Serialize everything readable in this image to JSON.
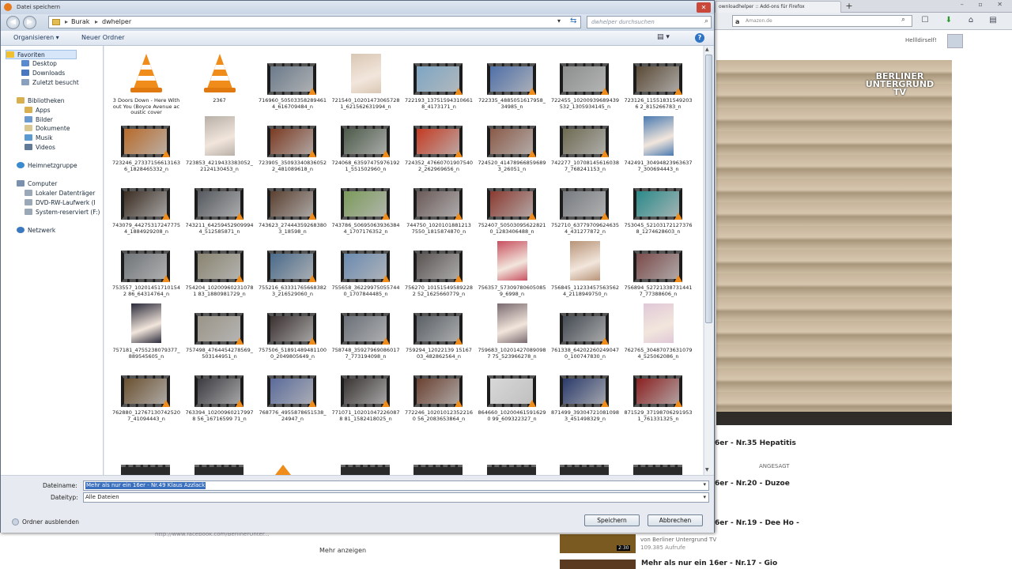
{
  "dialog": {
    "title": "Datei speichern",
    "breadcrumb": [
      "Burak",
      "dwhelper"
    ],
    "search_placeholder": "dwhelper durchsuchen",
    "toolbar": {
      "organize": "Organisieren ▾",
      "new_folder": "Neuer Ordner"
    },
    "nav": {
      "favorites": "Favoriten",
      "desktop": "Desktop",
      "downloads": "Downloads",
      "recent": "Zuletzt besucht",
      "libraries": "Bibliotheken",
      "apps": "Apps",
      "pictures": "Bilder",
      "documents": "Dokumente",
      "music": "Musik",
      "videos": "Videos",
      "homegroup": "Heimnetzgruppe",
      "computer": "Computer",
      "local_disk": "Lokaler Datenträger",
      "dvd": "DVD-RW-Laufwerk (I",
      "system_reserved": "System-reserviert (F:)",
      "network": "Netzwerk"
    },
    "files": [
      {
        "name": "3 Doors Down - Here Without You (Boyce Avenue acoustic cover",
        "kind": "vlc"
      },
      {
        "name": "2367",
        "kind": "vlc"
      },
      {
        "name": "716960_505033582894614_616709484_n",
        "kind": "video",
        "color": "#6b7a8a"
      },
      {
        "name": "721540_102014730657281_621562631994_n",
        "kind": "photo",
        "color": "#d9c7b4"
      },
      {
        "name": "722193_137515943106618_4173171_n",
        "kind": "video",
        "color": "#7da6c4"
      },
      {
        "name": "722335_4885051617958_34985_n",
        "kind": "video",
        "color": "#4f6fa8"
      },
      {
        "name": "722455_10200939689439532_1305934145_n",
        "kind": "video",
        "color": "#8d8f8f"
      },
      {
        "name": "723126_115518315492036 2_815266783_n",
        "kind": "video",
        "color": "#5a4a36"
      },
      {
        "name": "723246_273371566131636_1828465332_n",
        "kind": "video",
        "color": "#b86a2a"
      },
      {
        "name": "723853_4219433383052_2124130453_n",
        "kind": "photo",
        "color": "#b8b0a8"
      },
      {
        "name": "723905_350933408360522_481089618_n",
        "kind": "video",
        "color": "#7a3a22"
      },
      {
        "name": "724068_635974759761921_551502960_n",
        "kind": "video",
        "color": "#4d5a4a"
      },
      {
        "name": "724352_476607019075402_262969656_n",
        "kind": "video",
        "color": "#c43a22"
      },
      {
        "name": "724520_414789668596893_26051_n",
        "kind": "video",
        "color": "#8a5a48"
      },
      {
        "name": "742277_107081456160387_768241153_n",
        "kind": "video",
        "color": "#6e6a52"
      },
      {
        "name": "742491_304948239636377_300694443_n",
        "kind": "photo",
        "color": "#4a7ab0"
      },
      {
        "name": "743079_442753172477754_1884929208_n",
        "kind": "video",
        "color": "#3a2c22"
      },
      {
        "name": "743211_642594529099944_512585871_n",
        "kind": "video",
        "color": "#55595e"
      },
      {
        "name": "743623_274443592683803_18598_n",
        "kind": "video",
        "color": "#5a4030"
      },
      {
        "name": "743786_506950639363844_1707176352_n",
        "kind": "video",
        "color": "#7b9a5a"
      },
      {
        "name": "744750_1020101881213 7550_1815874870_n",
        "kind": "video",
        "color": "#6a5a58"
      },
      {
        "name": "752407_505030956228210_1283406488_n",
        "kind": "video",
        "color": "#8a3a30"
      },
      {
        "name": "752710_637797096246354_431277872_n",
        "kind": "video",
        "color": "#777b80"
      },
      {
        "name": "753045_521031721273768_1274628603_n",
        "kind": "video",
        "color": "#2a8a8a"
      },
      {
        "name": "753557_102014517101542 86_64314764_n",
        "kind": "video",
        "color": "#707478"
      },
      {
        "name": "754204_102009602310781 83_1880981729_n",
        "kind": "video",
        "color": "#8a8470"
      },
      {
        "name": "755216_633317656683823_216529060_n",
        "kind": "video",
        "color": "#4a6a8a"
      },
      {
        "name": "755658_362299750557440_1707844485_n",
        "kind": "video",
        "color": "#6a8ab0"
      },
      {
        "name": "756270_101515495892282 52_1625660779_n",
        "kind": "video",
        "color": "#5a5452"
      },
      {
        "name": "756357_573097806050859_6998_n",
        "kind": "photo",
        "color": "#c85060"
      },
      {
        "name": "756845_112334575635624_2118949750_n",
        "kind": "photo",
        "color": "#b89478"
      },
      {
        "name": "756894_527213387314417_77388606_n",
        "kind": "video",
        "color": "#7a4a4a"
      },
      {
        "name": "757181_4755238079377_889545605_n",
        "kind": "photo",
        "color": "#2a2a3a"
      },
      {
        "name": "757498_4764454278569_503144951_n",
        "kind": "video",
        "color": "#9a9488"
      },
      {
        "name": "757506_518914894811000_2049805649_n",
        "kind": "video",
        "color": "#3a3030"
      },
      {
        "name": "758748_359279690860177_773194098_n",
        "kind": "video",
        "color": "#6a7078"
      },
      {
        "name": "759294_12022139 1516703_482862564_n",
        "kind": "video",
        "color": "#5a6066"
      },
      {
        "name": "759683_102014270890987 75_523966278_n",
        "kind": "photo",
        "color": "#7a6a70"
      },
      {
        "name": "761338_642022602490470_100747830_n",
        "kind": "video",
        "color": "#444a52"
      },
      {
        "name": "762765_304870736310794_525062086_n",
        "kind": "photo",
        "color": "#e0c8d8"
      },
      {
        "name": "762880_127671307425207_41094443_n",
        "kind": "video",
        "color": "#6a5030"
      },
      {
        "name": "763394_102009602179978 56_16716599 71_n",
        "kind": "video",
        "color": "#3a3a40"
      },
      {
        "name": "768776_4955878651538_24947_n",
        "kind": "video",
        "color": "#5a6a9a"
      },
      {
        "name": "771071_102010472260878 81_1582418025_n",
        "kind": "video",
        "color": "#3a3434"
      },
      {
        "name": "772246_102010123522160 56_2083653864_n",
        "kind": "video",
        "color": "#6a4030"
      },
      {
        "name": "864660_102004615916290 99_609322327_n",
        "kind": "video",
        "color": "#d8d8d8"
      },
      {
        "name": "871499_393047210810983_451498329_n",
        "kind": "video",
        "color": "#2a3a6a"
      },
      {
        "name": "871529_371987062919531_761331325_n",
        "kind": "video",
        "color": "#8a2020"
      }
    ],
    "filename_label": "Dateiname:",
    "filename_value": "Mehr als nur ein 16er - Nr.49 Klaus Azzlack",
    "filetype_label": "Dateityp:",
    "filetype_value": "Alle Dateien",
    "hide_folders": "Ordner ausblenden",
    "save": "Speichern",
    "cancel": "Abbrechen"
  },
  "browser": {
    "tab1": "ownloadhelper :: Add-ons für Firefox",
    "new_tab": "+",
    "search_placeholder": "Amazon.de",
    "greeting": "Hellldirself!",
    "video_logo": "BERLINER UNTERGRUND TV",
    "related": [
      "6er - Nr.35 Hepatitis",
      "6er - Nr.20 - Duzoe",
      "6er - Nr.19 - Dee Ho -",
      "Mehr als nur ein 16er - Nr.17 - Gio"
    ],
    "subscribed": "ANGESAGT",
    "facebook": "http://www.facebook.com/BerlinerUnter...",
    "more": "Mehr anzeigen",
    "thumb_duration": "2:30",
    "channel": "von Berliner Untergrund TV",
    "views": "109.385 Aufrufe"
  },
  "colors": {
    "accent": "#3a6fbd",
    "vlc": "#f08c1a",
    "close": "#c9483a"
  }
}
